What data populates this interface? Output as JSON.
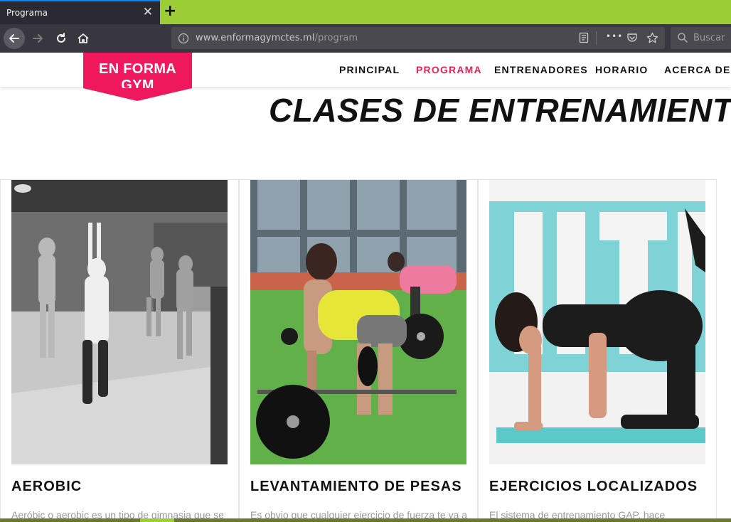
{
  "browser": {
    "tab_title": "Programa",
    "tab_close": "✕",
    "new_tab": "+",
    "url_domain": "www.enformagymctes.ml",
    "url_path": "/program",
    "search_placeholder": "Buscar",
    "more_glyph": "•••"
  },
  "site": {
    "logo": "EN FORMA GYM",
    "accent_color": "#f0185d",
    "nav": [
      {
        "label": "PRINCIPAL"
      },
      {
        "label": "PROGRAMA",
        "active": true
      },
      {
        "label": "ENTRENADORES"
      },
      {
        "label": "HORARIO"
      },
      {
        "label": "ACERCA DE"
      }
    ]
  },
  "main": {
    "title": "CLASES DE ENTRENAMIENTO",
    "cards": [
      {
        "title": "AEROBIC",
        "description": "Aeróbic o aerobic es un tipo de gimnasia que se",
        "image": "aerobic-class-photo"
      },
      {
        "title": "LEVANTAMIENTO DE PESAS",
        "description": "Es obvio que cualquier ejercicio de fuerza te va a",
        "image": "deadlift-photo"
      },
      {
        "title": "EJERCICIOS LOCALIZADOS",
        "description": "El sistema de entrenamiento GAP, hace",
        "image": "floor-exercise-photo"
      }
    ]
  }
}
